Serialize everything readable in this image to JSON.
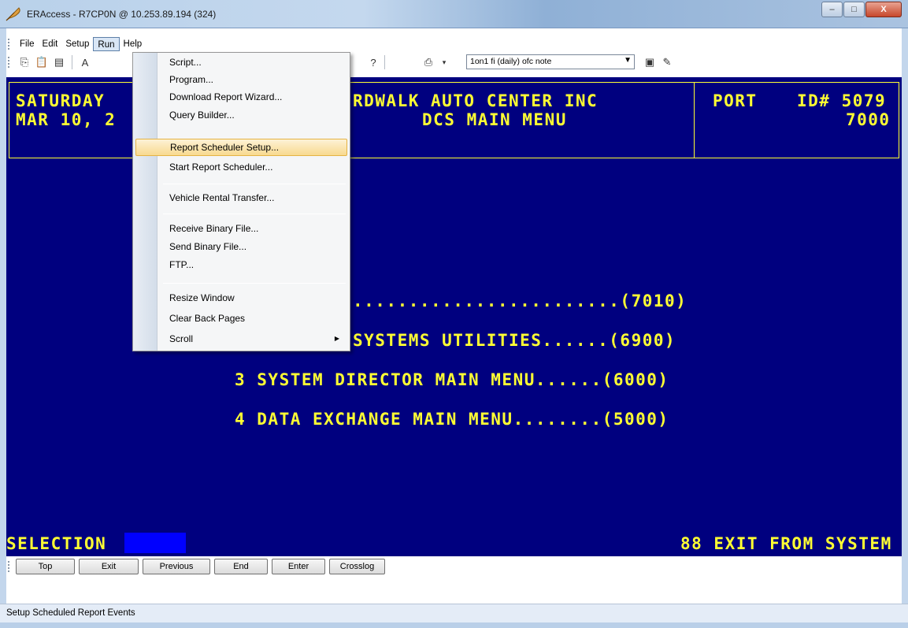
{
  "window": {
    "title": "ERAccess - R7CP0N @ 10.253.89.194 (324)",
    "minimize": "–",
    "maximize": "□",
    "close": "X"
  },
  "menubar": {
    "file": "File",
    "edit": "Edit",
    "setup": "Setup",
    "run": "Run",
    "help": "Help"
  },
  "toolbar": {
    "combo_value": "1on1 fi (daily) ofc note"
  },
  "terminal": {
    "header_left_1": "SATURDAY",
    "header_left_2": "MAR 10, 2",
    "header_center_1": "RDWALK AUTO CENTER INC",
    "header_center_2": "DCS MAIN MENU",
    "header_port": "PORT",
    "header_id": "ID# 5079",
    "header_num": "7000",
    "menu_line_1": "........................(7010)",
    "menu_line_2": "SYSTEMS UTILITIES......(6900)",
    "menu_line_3": "3 SYSTEM DIRECTOR MAIN MENU......(6000)",
    "menu_line_4": "4 DATA EXCHANGE MAIN MENU........(5000)",
    "selection_label": "SELECTION",
    "exit_label": "88 EXIT FROM SYSTEM"
  },
  "buttons": {
    "top": "Top",
    "exit": "Exit",
    "previous": "Previous",
    "end": "End",
    "enter": "Enter",
    "crosslog": "Crosslog"
  },
  "run_menu": {
    "items": [
      {
        "label": "Script..."
      },
      {
        "label": "Program..."
      },
      {
        "label": "Download Report Wizard..."
      },
      {
        "label": "Query Builder..."
      },
      {
        "label": "Report Scheduler Setup..."
      },
      {
        "label": "Start Report Scheduler..."
      },
      {
        "label": "Vehicle Rental Transfer..."
      },
      {
        "label": "Receive Binary File..."
      },
      {
        "label": "Send Binary File..."
      },
      {
        "label": "FTP..."
      },
      {
        "label": "Resize Window"
      },
      {
        "label": "Clear Back Pages"
      },
      {
        "label": "Scroll"
      }
    ]
  },
  "status": {
    "text": "Setup Scheduled Report Events"
  }
}
